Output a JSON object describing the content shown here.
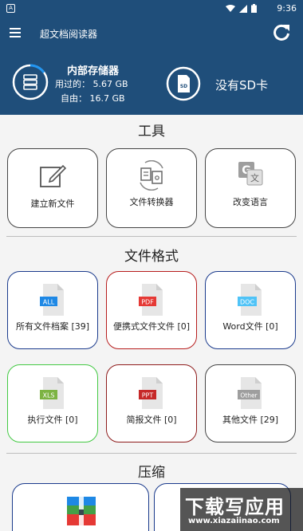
{
  "status_bar": {
    "time": "9:36",
    "app_badge": "A"
  },
  "app_bar": {
    "title": "超文档阅读器"
  },
  "storage": {
    "internal_title": "内部存储器",
    "used_label": "用过的：",
    "used_value": "5.67 GB",
    "free_label": "自由：",
    "free_value": "16.7 GB",
    "sd_icon_text": "SD",
    "sd_label": "没有SD卡"
  },
  "tools": {
    "title": "工具",
    "items": [
      {
        "label": "建立新文件",
        "icon": "new-file-pencil-icon"
      },
      {
        "label": "文件转换器",
        "icon": "file-converter-icon"
      },
      {
        "label": "改变语言",
        "icon": "translate-icon"
      }
    ]
  },
  "formats": {
    "title": "文件格式",
    "items": [
      {
        "label": "所有文件档案 [39]",
        "badge": "ALL",
        "badge_color": "#1e88e5",
        "border_color": "#1a3a8c"
      },
      {
        "label": "便携式文件文件 [0]",
        "badge": "PDF",
        "badge_color": "#e53935",
        "border_color": "#b71c1c"
      },
      {
        "label": "Word文件 [0]",
        "badge": "DOC",
        "badge_color": "#4fc3f7",
        "border_color": "#1a3a8c"
      },
      {
        "label": "执行文件 [0]",
        "badge": "XLS",
        "badge_color": "#7cb342",
        "border_color": "#43c943"
      },
      {
        "label": "简报文件 [0]",
        "badge": "PPT",
        "badge_color": "#c62828",
        "border_color": "#8e1b1b"
      },
      {
        "label": "其他文件 [29]",
        "badge": "Other",
        "badge_color": "#9e9e9e",
        "border_color": "#444444"
      }
    ]
  },
  "compress": {
    "title": "压缩"
  },
  "watermark": {
    "big": "下载写应用",
    "small": "www.xiazaiinao.com"
  }
}
